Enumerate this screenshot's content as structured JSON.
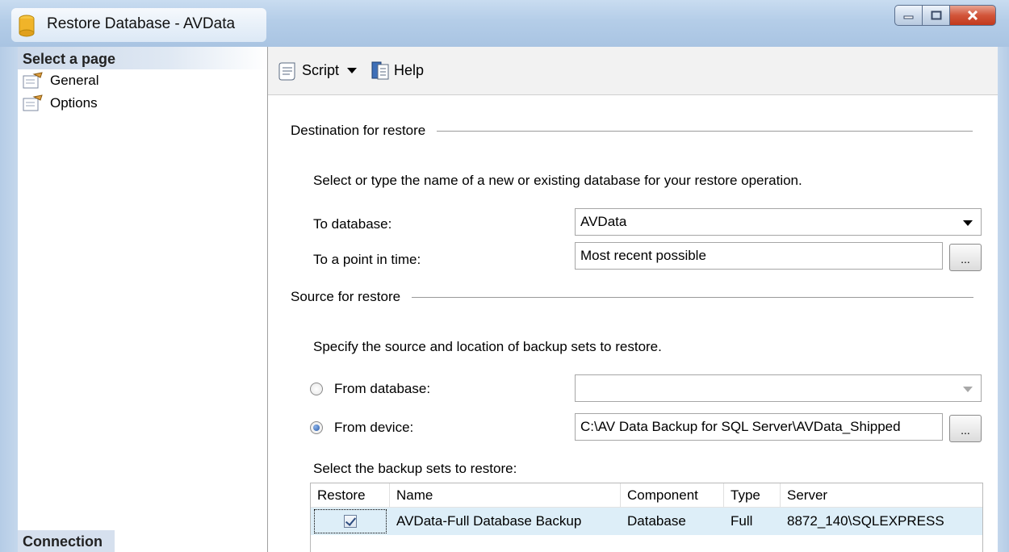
{
  "window": {
    "title": "Restore Database - AVData",
    "controls": {
      "minimize": "minimize-icon",
      "maximize": "maximize-icon",
      "close": "close-icon"
    }
  },
  "left_pane": {
    "select_header": "Select a page",
    "pages": [
      {
        "label": "General",
        "icon": "page-wrench-icon"
      },
      {
        "label": "Options",
        "icon": "page-wrench-icon"
      }
    ],
    "connection_header": "Connection"
  },
  "toolbar": {
    "script_label": "Script",
    "help_label": "Help"
  },
  "destination": {
    "section_title": "Destination for restore",
    "description": "Select or type the name of a new or existing database for your restore operation.",
    "to_database_label": "To database:",
    "to_database_value": "AVData",
    "point_in_time_label": "To a point in time:",
    "point_in_time_value": "Most recent possible",
    "browse_label": "..."
  },
  "source": {
    "section_title": "Source for restore",
    "description": "Specify the source and location of backup sets to restore.",
    "from_database_label": "From database:",
    "from_database_value": "",
    "from_device_label": "From device:",
    "from_device_value": "C:\\AV Data Backup for SQL Server\\AVData_Shipped",
    "browse_label": "...",
    "selected_option": "From device"
  },
  "backup_sets": {
    "label": "Select the backup sets to restore:",
    "columns": [
      "Restore",
      "Name",
      "Component",
      "Type",
      "Server"
    ],
    "rows": [
      {
        "restore": true,
        "name": "AVData-Full Database Backup",
        "component": "Database",
        "type": "Full",
        "server": "8872_140\\SQLEXPRESS"
      }
    ]
  }
}
